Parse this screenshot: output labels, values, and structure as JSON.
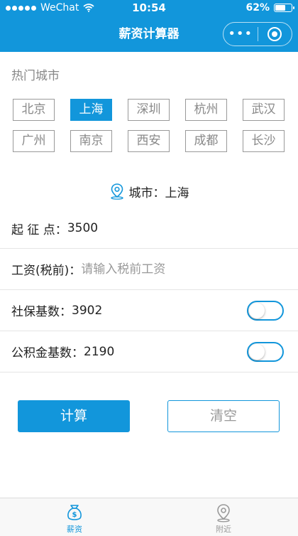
{
  "status_bar": {
    "carrier": "WeChat",
    "time": "10:54",
    "battery": "62%",
    "battery_level": 0.62
  },
  "nav": {
    "title": "薪资计算器",
    "more": "•••"
  },
  "hot_cities": {
    "title": "热门城市",
    "items": [
      {
        "label": "北京",
        "active": false
      },
      {
        "label": "上海",
        "active": true
      },
      {
        "label": "深圳",
        "active": false
      },
      {
        "label": "杭州",
        "active": false
      },
      {
        "label": "武汉",
        "active": false
      },
      {
        "label": "广州",
        "active": false
      },
      {
        "label": "南京",
        "active": false
      },
      {
        "label": "西安",
        "active": false
      },
      {
        "label": "成都",
        "active": false
      },
      {
        "label": "长沙",
        "active": false
      }
    ]
  },
  "current_city": "城市：上海",
  "form": {
    "threshold_label": "起 征 点：",
    "threshold_value": "3500",
    "salary_label": "工资(税前)：",
    "salary_value": "",
    "salary_placeholder": "请输入税前工资",
    "social_label": "社保基数：",
    "social_value": "3902",
    "social_toggle_on": false,
    "fund_label": "公积金基数：",
    "fund_value": "2190",
    "fund_toggle_on": false
  },
  "buttons": {
    "calculate": "计算",
    "clear": "清空"
  },
  "tabbar": {
    "items": [
      {
        "label": "薪资",
        "icon": "money-bag-icon",
        "active": true
      },
      {
        "label": "附近",
        "icon": "location-icon",
        "active": false
      }
    ]
  },
  "colors": {
    "accent": "#1296db",
    "muted_text": "#888888",
    "border": "#999999"
  }
}
